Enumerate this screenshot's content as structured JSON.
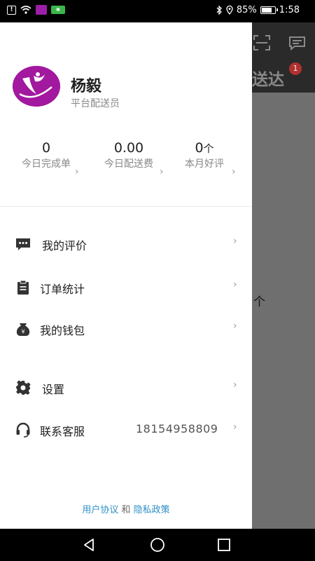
{
  "status_bar": {
    "battery_percent": "85%",
    "battery_level": 0.85,
    "time": "1:58",
    "icons": [
      "notification-icon",
      "wifi-icon",
      "app-icon",
      "app-badge-icon",
      "bluetooth-icon",
      "location-icon",
      "battery-icon"
    ]
  },
  "background_app": {
    "title_fragment": "送达",
    "badge_count": "1",
    "text_fragment": "个",
    "icons": [
      "scan-icon",
      "message-icon"
    ]
  },
  "drawer": {
    "user": {
      "name": "杨毅",
      "role": "平台配送员"
    },
    "stats": [
      {
        "value": "0",
        "unit": "",
        "label": "今日完成单"
      },
      {
        "value": "0.00",
        "unit": "",
        "label": "今日配送费"
      },
      {
        "value": "0",
        "unit": "个",
        "label": "本月好评"
      }
    ],
    "menu": [
      {
        "label": "我的评价",
        "icon": "comment-icon",
        "value": ""
      },
      {
        "label": "订单统计",
        "icon": "clipboard-icon",
        "value": ""
      },
      {
        "label": "我的钱包",
        "icon": "wallet-icon",
        "value": ""
      },
      {
        "label": "设置",
        "icon": "gear-icon",
        "value": ""
      },
      {
        "label": "联系客服",
        "icon": "headset-icon",
        "value": "18154958809"
      }
    ],
    "footer": {
      "user_agreement": "用户协议",
      "conjunction": "和",
      "privacy_policy": "隐私政策"
    }
  },
  "nav_bar": {
    "icons": [
      "back-icon",
      "home-icon",
      "recents-icon"
    ]
  },
  "colors": {
    "link": "#2e8fc7",
    "avatar_bg": "#a2189f",
    "text_primary": "#222222",
    "text_secondary": "#888888"
  }
}
